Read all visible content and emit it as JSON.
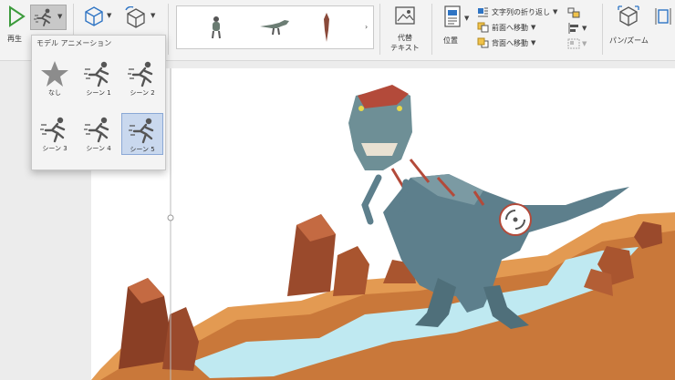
{
  "ribbon": {
    "play_label": "再生",
    "alt_text_label_line1": "代替",
    "alt_text_label_line2": "テキスト",
    "position_label": "位置",
    "wrap_text_label": "文字列の折り返し",
    "bring_forward_label": "前面へ移動",
    "send_backward_label": "背面へ移動",
    "pan_zoom_label": "パン/ズーム"
  },
  "dropdown": {
    "title": "モデル アニメーション",
    "items": [
      {
        "label": "なし",
        "icon": "star-icon",
        "selected": false
      },
      {
        "label": "シーン 1",
        "icon": "runner-icon",
        "selected": false
      },
      {
        "label": "シーン 2",
        "icon": "runner-icon",
        "selected": false
      },
      {
        "label": "シーン 3",
        "icon": "runner-icon",
        "selected": false
      },
      {
        "label": "シーン 4",
        "icon": "runner-icon",
        "selected": false
      },
      {
        "label": "シーン 5",
        "icon": "runner-icon",
        "selected": true
      }
    ]
  },
  "colors": {
    "play_green": "#3c9b3c",
    "cube_blue": "#2e74c4",
    "selection": "#c9d8ee",
    "water": "#bfe9f1",
    "ground": "#e39a52"
  }
}
